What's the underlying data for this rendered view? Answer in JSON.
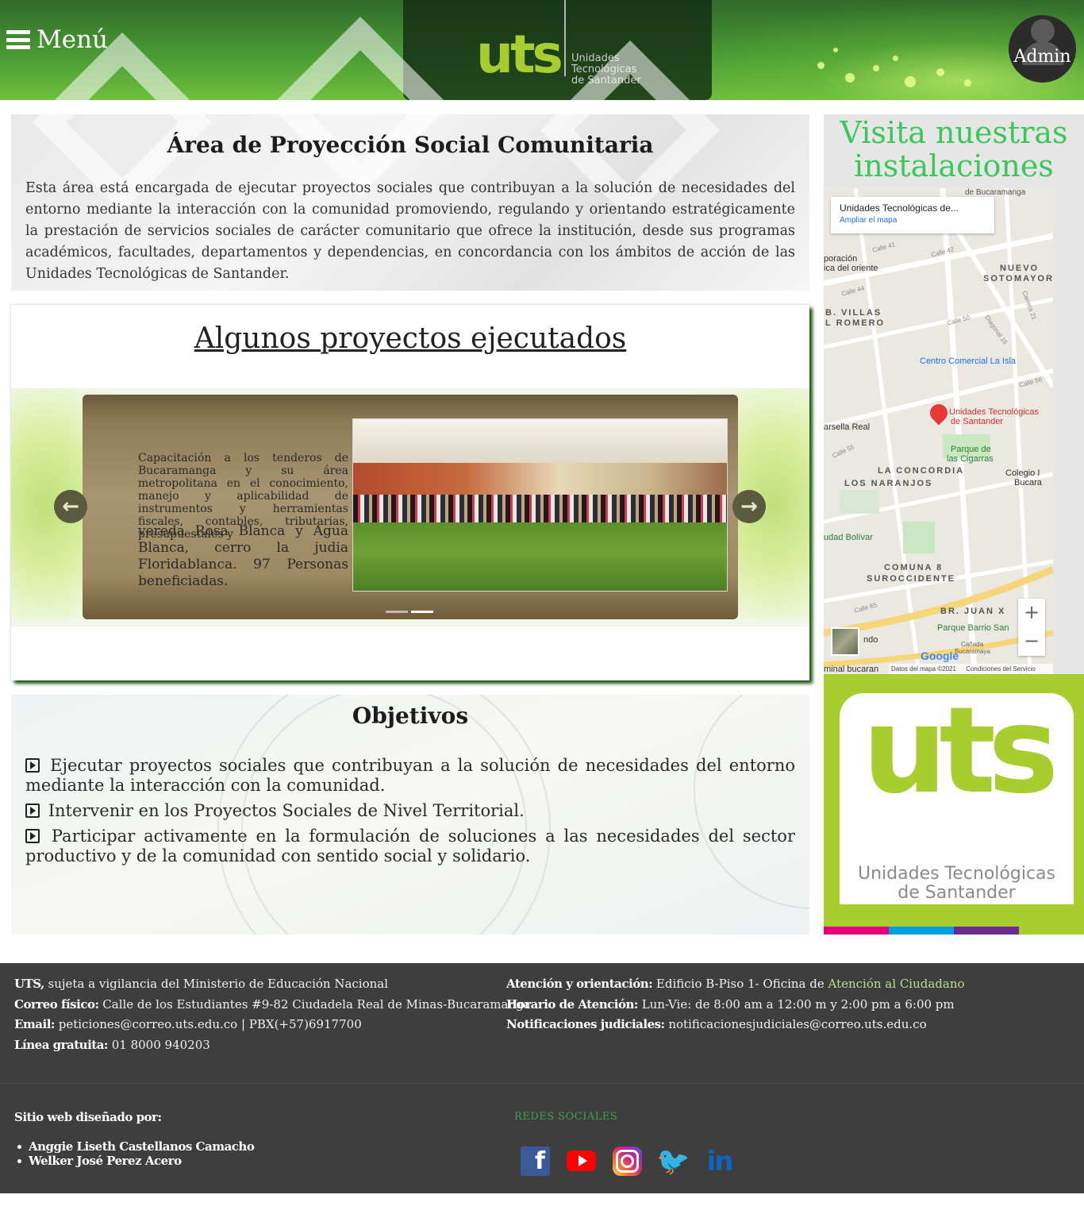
{
  "header": {
    "menu_label": "Menú",
    "logo_letters": "uts",
    "logo_subtitle_1": "Unidades",
    "logo_subtitle_2": "Tecnológicas",
    "logo_subtitle_3": "de Santander",
    "admin_label": "Admin"
  },
  "area": {
    "title": "Área de Proyección Social Comunitaria",
    "text": "Esta área está encargada de ejecutar proyectos sociales que contribuyan a la solución de necesidades del entorno mediante la interacción con la comunidad promoviendo, regulando y orientando estratégicamente la prestación de servicios sociales de carácter comunitario que ofrece la institución, desde sus programas académicos, facultades, departamentos y dependencias, en concordancia con los ámbitos de acción de las Unidades Tecnológicas de Santander."
  },
  "projects": {
    "title": "Algunos proyectos ejecutados",
    "slide_text_back": "Capacitación a los tenderos de Bucaramanga y su área metropolitana en el conocimiento, manejo y aplicabilidad de instrumentos y herramientas fiscales, contables, tributarias, presupuestales y",
    "slide_text_front": "vereda Rosa Blanca y Agua Blanca, cerro la judia Floridablanca. 97 Personas beneficiadas.",
    "prev_icon": "arrow-left-icon",
    "next_icon": "arrow-right-icon",
    "slide_count": 2,
    "active_slide": 2
  },
  "objectives": {
    "title": "Objetivos",
    "items": [
      "Ejecutar proyectos sociales que contribuyan a la solución de necesidades del entorno mediante la interacción con la comunidad.",
      "Intervenir en los Proyectos Sociales de Nivel Territorial.",
      "Participar activamente en la formulación de soluciones a las necesidades del sector productivo y de la comunidad con sentido social y solidario."
    ]
  },
  "sidebar": {
    "visit_title": "Visita nuestras instalaciones",
    "map": {
      "card_title": "Unidades Tecnológicas de...",
      "card_link": "Ampliar el mapa",
      "pin_label_1": "Unidades Tecnológicas",
      "pin_label_2": "de Santander",
      "labels": {
        "bucaramanga": "de Bucaramanga",
        "nuevo": "NUEVO",
        "sotomayor": "SOTOMAYOR",
        "villas": "B. VILLAS",
        "romero": "L ROMERO",
        "poracion": "poración",
        "oriente": "ica del oriente",
        "la_isla": "Centro Comercial La Isla",
        "marsella": "arsella Real",
        "parque_1": "Parque de",
        "parque_2": "las Cigarras",
        "concordia": "LA CONCORDIA",
        "naranjos": "LOS NARANJOS",
        "colegio": "Colegio I",
        "bucara": "Bucara",
        "bolivar": "udad Bolívar",
        "comuna_1": "COMUNA 8",
        "comuna_2": "SUROCCIDENTE",
        "juan": "BR. JUAN X",
        "parque_barrio": "Parque Barrio San",
        "ndo": "ndo",
        "canada": "Cañada",
        "camaya": "Bucaramaya",
        "bucaran": "minal bucaran",
        "calle_41": "Calle 41",
        "calle_42": "Calle 42",
        "calle_44": "Calle 44",
        "calle_50": "Calle 50",
        "calle_56": "Calle 56",
        "calle_55": "Calle 55",
        "calle_65": "Calle 65",
        "diagonal": "Diagonal 15",
        "carrera_21": "Carrera 21"
      },
      "zoom_in": "+",
      "zoom_out": "−",
      "google": "Google",
      "footer_data": "Datos del mapa ©2021",
      "footer_terms": "Condiciones del Servicio"
    },
    "big_logo_letters": "uts",
    "big_logo_sub_1": "Unidades Tecnológicas",
    "big_logo_sub_2": "de Santander",
    "stripe_colors": [
      "#e6007e",
      "#00a0e3",
      "#6a2c91",
      "#a7cd2f"
    ]
  },
  "footer": {
    "uts_label": "UTS,",
    "uts_text": " sujeta a vigilancia del Ministerio de Educación Nacional",
    "correo_label": "Correo físico:",
    "correo_text": " Calle de los Estudiantes #9-82 Ciudadela Real de Minas-Bucaramanga",
    "email_label": "Email:",
    "email_text": " peticiones@correo.uts.edu.co | PBX(+57)6917700",
    "linea_label": "Línea gratuita:",
    "linea_text": " 01 8000 940203",
    "atencion_label": "Atención y orientación:",
    "atencion_text": " Edificio B-Piso 1- Oficina de ",
    "atencion_link": "Atención al Ciudadano",
    "horario_label": "Horario de Atención:",
    "horario_text": " Lun-Vie: de 8:00 am a 12:00 m y 2:00 pm a 6:00 pm",
    "notif_label": "Notificaciones judiciales:",
    "notif_text": " notificacionesjudiciales@correo.uts.edu.co",
    "designed_by": "Sitio web diseñado por:",
    "designers": [
      "Anggie Liseth Castellanos Camacho",
      "Welker José Perez Acero"
    ],
    "redes": "REDES SOCIALES",
    "social_icons": [
      "facebook-icon",
      "youtube-icon",
      "instagram-icon",
      "twitter-icon",
      "linkedin-icon"
    ],
    "fb_glyph": "f",
    "tw_glyph": "🐦",
    "in_glyph": "in"
  }
}
